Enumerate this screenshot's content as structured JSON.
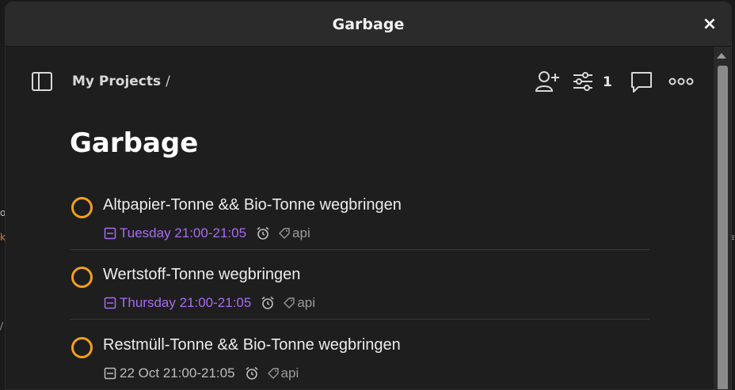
{
  "window": {
    "title": "Garbage",
    "close_label": "×"
  },
  "breadcrumb": {
    "root": "My Projects",
    "separator": "/"
  },
  "toolbar": {
    "filter_count": "1"
  },
  "page": {
    "title": "Garbage"
  },
  "tasks": [
    {
      "name": "Altpapier-Tonne && Bio-Tonne wegbringen",
      "due": "Tuesday 21:00-21:05",
      "due_color": "#a66cf0",
      "label": "api"
    },
    {
      "name": "Wertstoff-Tonne wegbringen",
      "due": "Thursday 21:00-21:05",
      "due_color": "#a66cf0",
      "label": "api"
    },
    {
      "name": "Restmüll-Tonne && Bio-Tonne wegbringen",
      "due": "22 Oct 21:00-21:05",
      "due_color": "#bdbdbd",
      "label": "api"
    }
  ],
  "colors": {
    "accent_priority": "#f0a020",
    "due_soon": "#a66cf0"
  },
  "icons": [
    "sidebar-toggle-icon",
    "add-person-icon",
    "filter-sliders-icon",
    "comment-icon",
    "more-icon",
    "calendar-icon",
    "alarm-icon",
    "tag-icon",
    "close-icon"
  ]
}
